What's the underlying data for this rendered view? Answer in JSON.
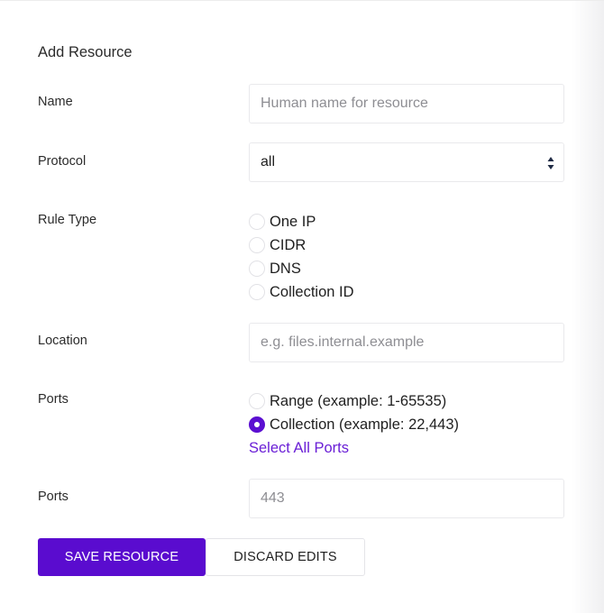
{
  "form": {
    "title": "Add Resource",
    "name": {
      "label": "Name",
      "placeholder": "Human name for resource",
      "value": ""
    },
    "protocol": {
      "label": "Protocol",
      "selected": "all"
    },
    "rule_type": {
      "label": "Rule Type",
      "options": [
        "One IP",
        "CIDR",
        "DNS",
        "Collection ID"
      ],
      "selected": null
    },
    "location": {
      "label": "Location",
      "placeholder": "e.g. files.internal.example",
      "value": ""
    },
    "ports_mode": {
      "label": "Ports",
      "options": [
        "Range (example: 1-65535)",
        "Collection (example: 22,443)"
      ],
      "selected": "Collection (example: 22,443)",
      "select_all_link": "Select All Ports"
    },
    "ports_value": {
      "label": "Ports",
      "placeholder": "443",
      "value": ""
    },
    "actions": {
      "save": "SAVE RESOURCE",
      "discard": "DISCARD EDITS"
    }
  },
  "colors": {
    "accent": "#5a0ccf",
    "link": "#6a1fd6",
    "border": "#e9e9ec"
  }
}
